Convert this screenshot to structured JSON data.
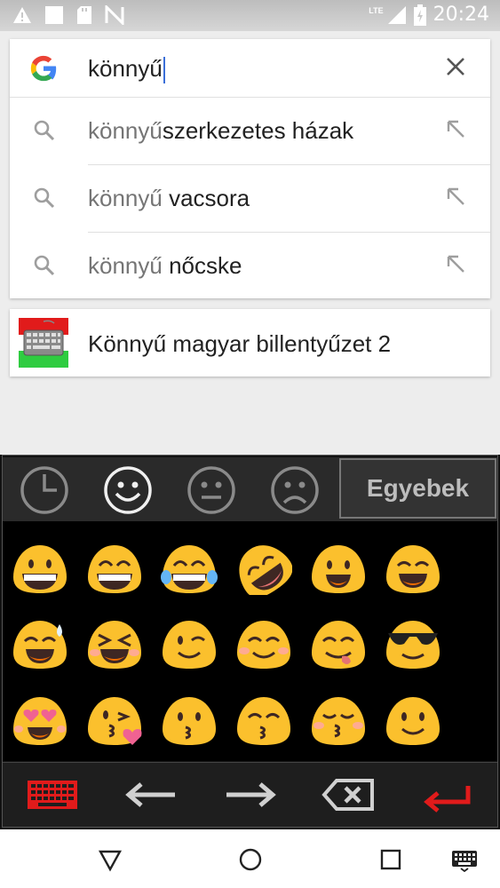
{
  "status_bar": {
    "time": "20:24",
    "network": "LTE",
    "left_icons": [
      "warning-icon",
      "image-icon",
      "sd-card-icon",
      "no-signal-icon"
    ],
    "right_icons": [
      "signal-icon",
      "battery-icon"
    ]
  },
  "search": {
    "query": "könnyű",
    "suggestions": [
      {
        "prefix": "könnyű",
        "suffix": "szerkezetes házak"
      },
      {
        "prefix": "könnyű",
        "suffix": " vacsora"
      },
      {
        "prefix": "könnyű",
        "suffix": " nőcske"
      }
    ]
  },
  "app_result": {
    "label": "Könnyű magyar billentyűzet 2"
  },
  "keyboard": {
    "tabs": [
      "recent-icon",
      "smiley-happy-icon",
      "smiley-neutral-icon",
      "smiley-sad-icon"
    ],
    "other_tab_label": "Egyebek",
    "emoji_rows": [
      [
        "grinning",
        "beaming",
        "tears-of-joy",
        "rolling-laughing",
        "smiling-open",
        "smiling-eyes-open"
      ],
      [
        "sweat-smile",
        "squinting-laugh",
        "winking",
        "smiling-blush",
        "savoring",
        "sunglasses"
      ],
      [
        "heart-eyes",
        "kissing-heart",
        "kissing",
        "kissing-smiling-eyes",
        "kissing-closed-eyes",
        "slight-smile"
      ]
    ],
    "bottom_buttons": [
      "keyboard-icon",
      "arrow-left-icon",
      "arrow-right-icon",
      "backspace-icon",
      "enter-icon"
    ],
    "colors": {
      "accent_red": "#e11b1b",
      "emoji_yellow": "#fbc02d"
    }
  },
  "nav_bar": {
    "buttons": [
      "back-icon",
      "home-icon",
      "recents-icon",
      "keyboard-switch-icon"
    ]
  }
}
